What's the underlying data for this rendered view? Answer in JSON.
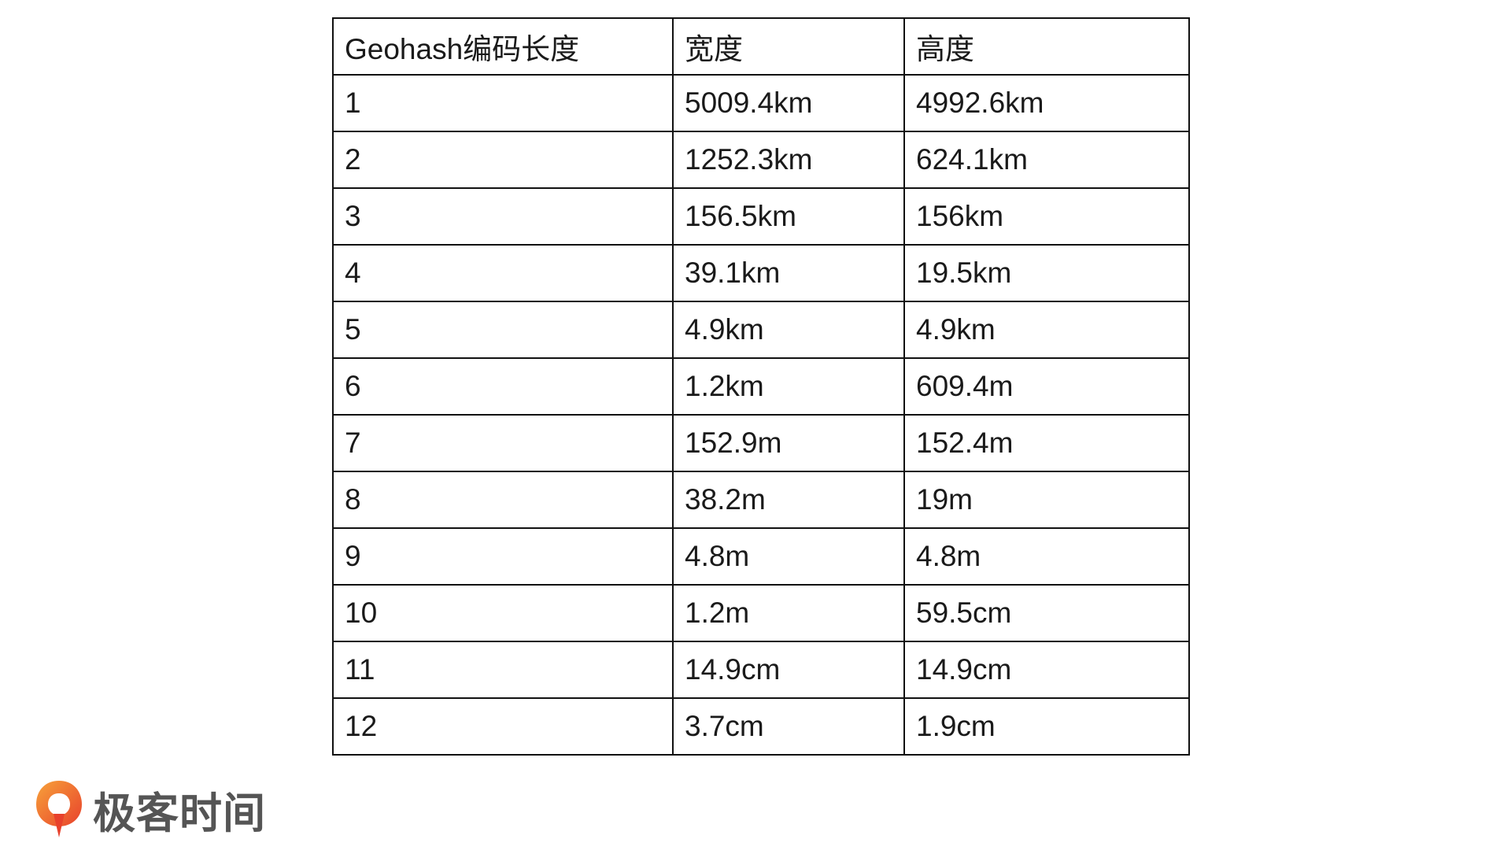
{
  "table": {
    "headers": [
      "Geohash编码长度",
      "宽度",
      "高度"
    ],
    "rows": [
      [
        "1",
        "5009.4km",
        "4992.6km"
      ],
      [
        "2",
        "1252.3km",
        "624.1km"
      ],
      [
        "3",
        "156.5km",
        "156km"
      ],
      [
        "4",
        "39.1km",
        "19.5km"
      ],
      [
        "5",
        "4.9km",
        "4.9km"
      ],
      [
        "6",
        "1.2km",
        "609.4m"
      ],
      [
        "7",
        "152.9m",
        "152.4m"
      ],
      [
        "8",
        "38.2m",
        "19m"
      ],
      [
        "9",
        "4.8m",
        "4.8m"
      ],
      [
        "10",
        "1.2m",
        "59.5cm"
      ],
      [
        "11",
        "14.9cm",
        "14.9cm"
      ],
      [
        "12",
        "3.7cm",
        "1.9cm"
      ]
    ]
  },
  "logo": {
    "text": "极客时间",
    "icon": "geektime-logo-icon",
    "colors": {
      "orange": "#f07a22",
      "red": "#e8412c",
      "text": "#555555"
    }
  }
}
